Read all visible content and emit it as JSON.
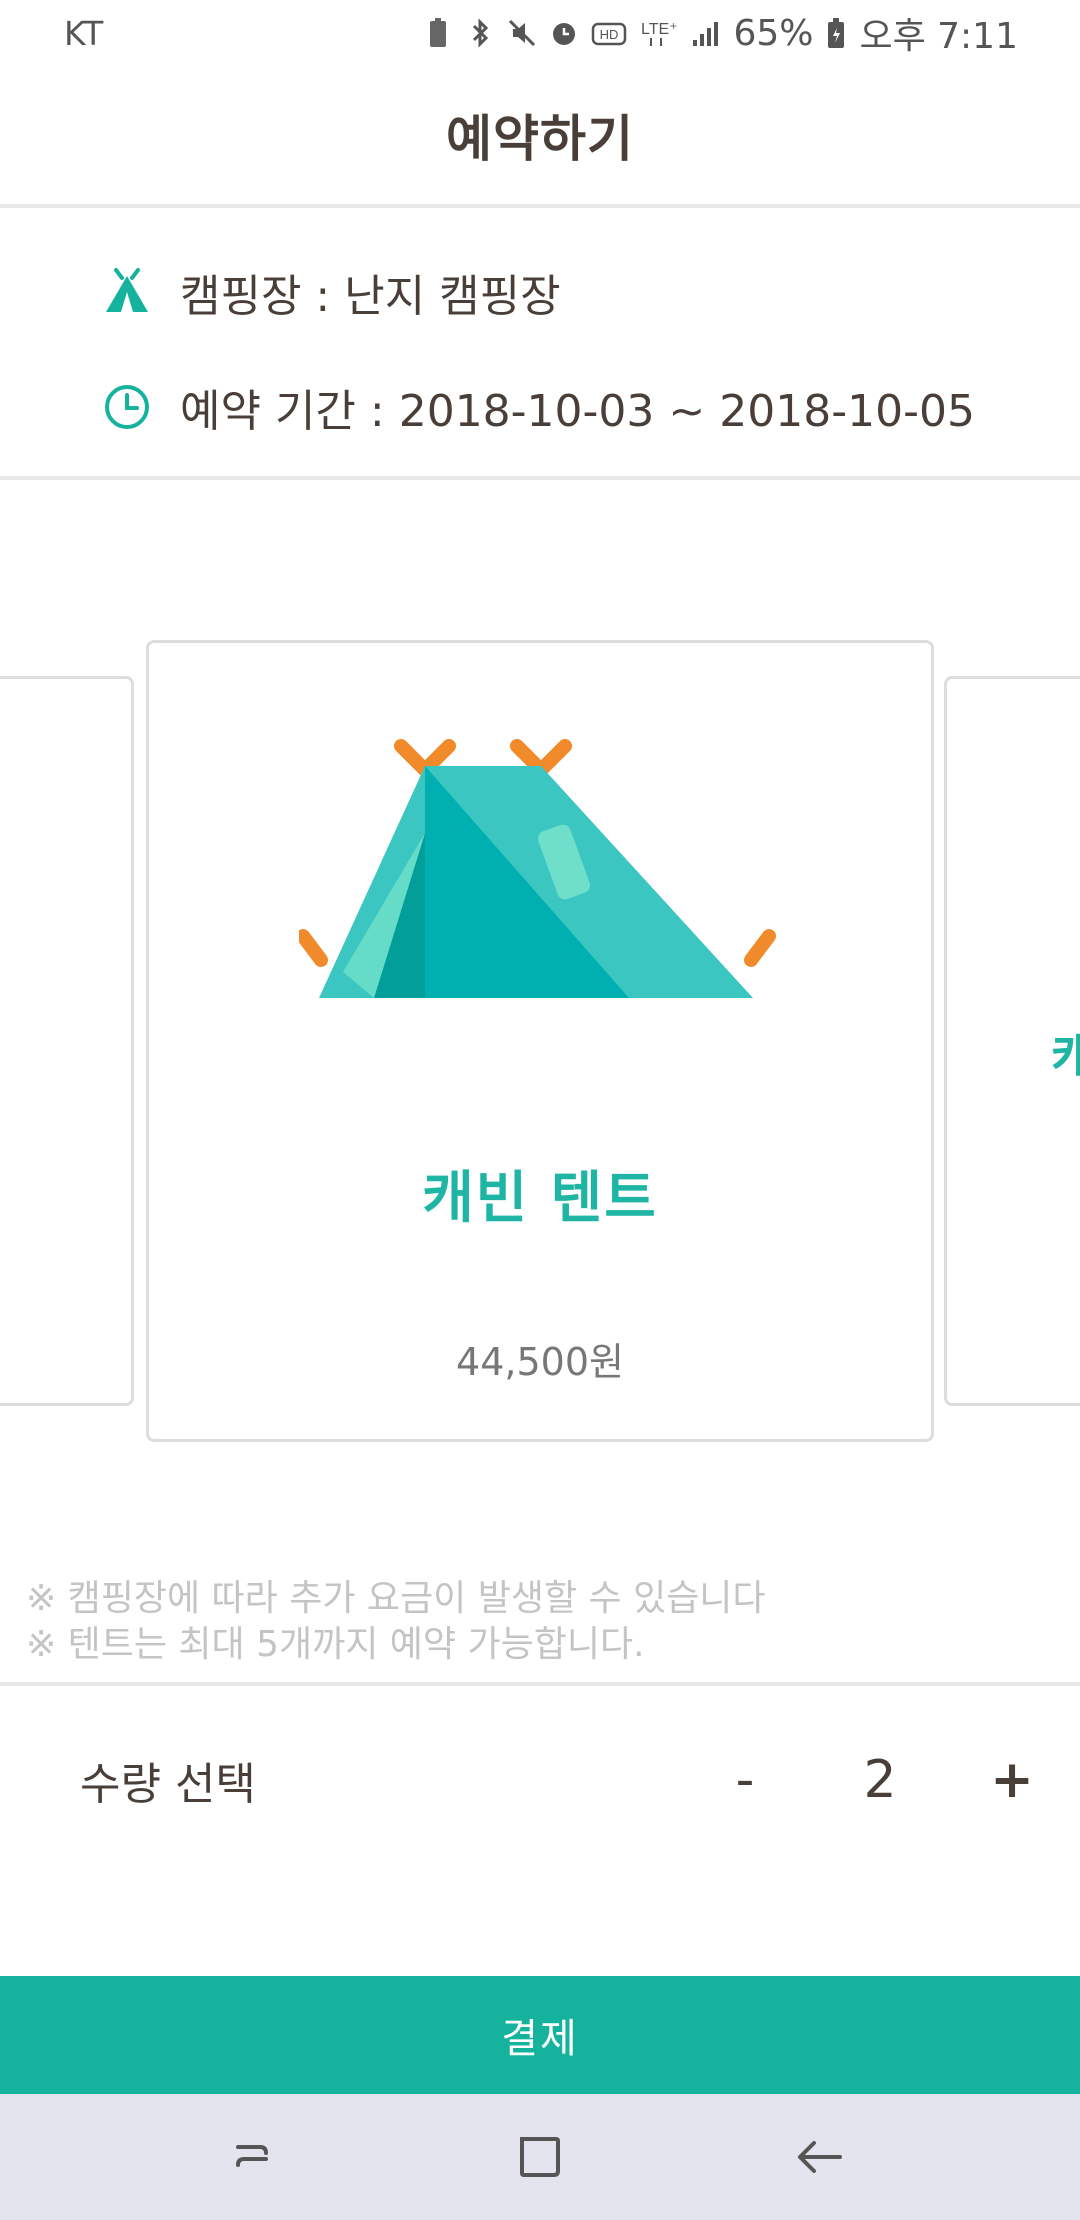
{
  "status_bar": {
    "carrier": "KT",
    "battery": "65%",
    "time": "오후 7:11",
    "icons": [
      "battery-saver-icon",
      "bluetooth-icon",
      "mute-icon",
      "alarm-icon",
      "hd-icon",
      "lte-icon",
      "signal-icon",
      "battery-icon"
    ]
  },
  "header": {
    "title": "예약하기"
  },
  "info": {
    "campsite": "캠핑장 : 난지 캠핑장",
    "period": "예약 기간 : 2018-10-03 ~ 2018-10-05"
  },
  "carousel": {
    "current": {
      "name": "캐빈 텐트",
      "price": "44,500원"
    },
    "next_peek": "캐"
  },
  "notes": [
    "※ 캠핑장에 따라 추가 요금이 발생할 수 있습니다",
    "※ 텐트는 최대 5개까지 예약 가능합니다."
  ],
  "quantity": {
    "label": "수량 선택",
    "minus": "-",
    "value": "2",
    "plus": "+"
  },
  "pay_button": "결제",
  "colors": {
    "accent": "#15b39d",
    "text": "#4a3f38",
    "tent_main": "#3cc6c1",
    "tent_dark": "#00b0b0",
    "tent_stakes": "#f08a2a"
  }
}
